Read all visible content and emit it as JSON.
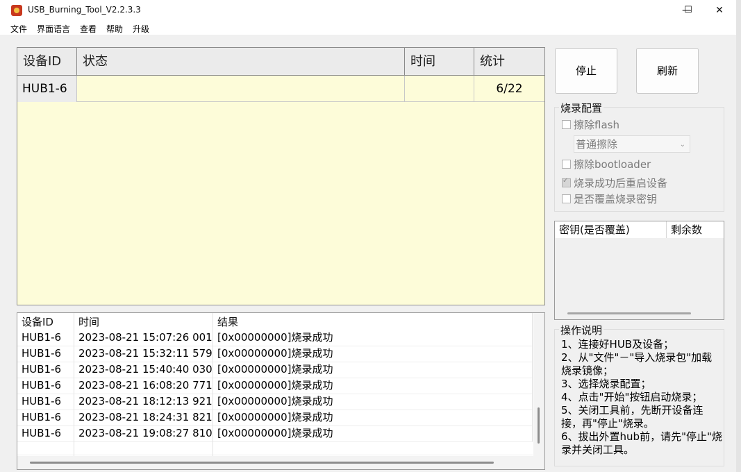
{
  "window": {
    "title": "USB_Burning_Tool_V2.2.3.3",
    "minimize": "—",
    "maximize": "☐",
    "close": "✕"
  },
  "menu": [
    "文件",
    "界面语言",
    "查看",
    "帮助",
    "升级"
  ],
  "device_table": {
    "headers": [
      "设备ID",
      "状态",
      "时间",
      "统计"
    ],
    "rows": [
      {
        "id": "HUB1-6",
        "status": "",
        "time": "",
        "count": "6/22"
      }
    ]
  },
  "buttons": {
    "stop": "停止",
    "refresh": "刷新"
  },
  "burn_config": {
    "title": "烧录配置",
    "erase_flash": {
      "label": "擦除flash",
      "checked": false
    },
    "erase_mode": "普通擦除",
    "erase_bootloader": {
      "label": "擦除bootloader",
      "checked": false
    },
    "reboot_after": {
      "label": "烧录成功后重启设备",
      "checked": true
    },
    "overwrite_key": {
      "label": "是否覆盖烧录密钥",
      "checked": false
    }
  },
  "key_table": {
    "headers": [
      "密钥(是否覆盖)",
      "剩余数"
    ]
  },
  "log_table": {
    "headers": [
      "设备ID",
      "时间",
      "结果"
    ],
    "rows": [
      {
        "id": "HUB1-6",
        "time": "2023-08-21 15:07:26 001",
        "result": "[0x00000000]烧录成功"
      },
      {
        "id": "HUB1-6",
        "time": "2023-08-21 15:32:11 579",
        "result": "[0x00000000]烧录成功"
      },
      {
        "id": "HUB1-6",
        "time": "2023-08-21 15:40:40 030",
        "result": "[0x00000000]烧录成功"
      },
      {
        "id": "HUB1-6",
        "time": "2023-08-21 16:08:20 771",
        "result": "[0x00000000]烧录成功"
      },
      {
        "id": "HUB1-6",
        "time": "2023-08-21 18:12:13 921",
        "result": "[0x00000000]烧录成功"
      },
      {
        "id": "HUB1-6",
        "time": "2023-08-21 18:24:31 821",
        "result": "[0x00000000]烧录成功"
      },
      {
        "id": "HUB1-6",
        "time": "2023-08-21 19:08:27 810",
        "result": "[0x00000000]烧录成功"
      }
    ]
  },
  "instructions": {
    "title": "操作说明",
    "lines": [
      "1、连接好HUB及设备；",
      "2、从\"文件\"－\"导入烧录包\"加载烧录镜像；",
      "3、选择烧录配置；",
      "4、点击\"开始\"按钮启动烧录；",
      "5、关闭工具前，先断开设备连接，再\"停止\"烧录。",
      "6、拔出外置hub前，请先\"停止\"烧录并关闭工具。"
    ]
  },
  "colors": {
    "table_bg": "#fdfcd9",
    "header_bg": "#ebebeb",
    "window_bg": "#f0f0f0"
  }
}
